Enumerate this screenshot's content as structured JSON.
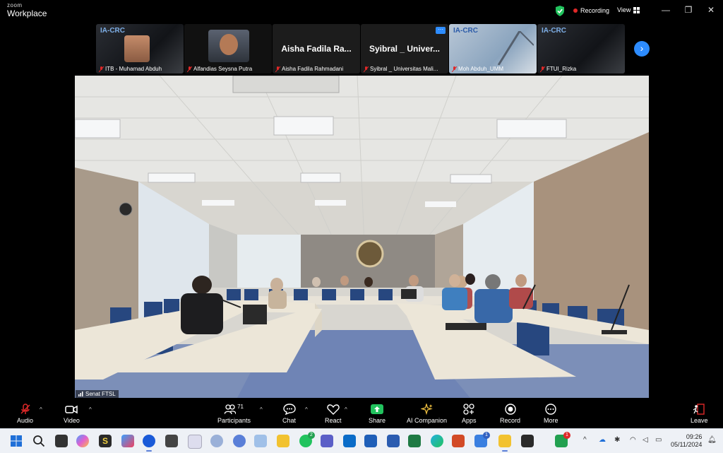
{
  "titlebar": {
    "brand_small": "zoom",
    "brand_large": "Workplace",
    "recording": "Recording",
    "view": "View"
  },
  "thumbnails": [
    {
      "name": "ITB - Muhamad Abduh",
      "logo": "IA-CRC",
      "muted": true
    },
    {
      "name": "Alfandias Seysna Putra",
      "logo": "",
      "muted": true
    },
    {
      "name": "Aisha Fadila Rahmadani",
      "display": "Aisha Fadila Ra...",
      "muted": true
    },
    {
      "name": "Syibral _ Universitas Mali...",
      "display": "Syibral _ Univer...",
      "muted": true
    },
    {
      "name": "Moh Abduh_UMM",
      "logo": "IA-CRC",
      "muted": true
    },
    {
      "name": "FTUI_Rizka",
      "logo": "IA-CRC",
      "muted": true
    }
  ],
  "main_video": {
    "speaker": "Senat FTSL"
  },
  "toolbar": {
    "audio": "Audio",
    "video": "Video",
    "participants": "Participants",
    "participants_count": "71",
    "chat": "Chat",
    "react": "React",
    "share": "Share",
    "ai_companion": "AI Companion",
    "apps": "Apps",
    "record": "Record",
    "more": "More",
    "leave": "Leave"
  },
  "taskbar": {
    "whatsapp_badge": "2",
    "todo_badge": "1",
    "notif_badge": "1",
    "time": "09:26",
    "date": "05/11/2024"
  },
  "colors": {
    "accent": "#2d8cff",
    "record": "#e02828",
    "share": "#22c35e"
  }
}
